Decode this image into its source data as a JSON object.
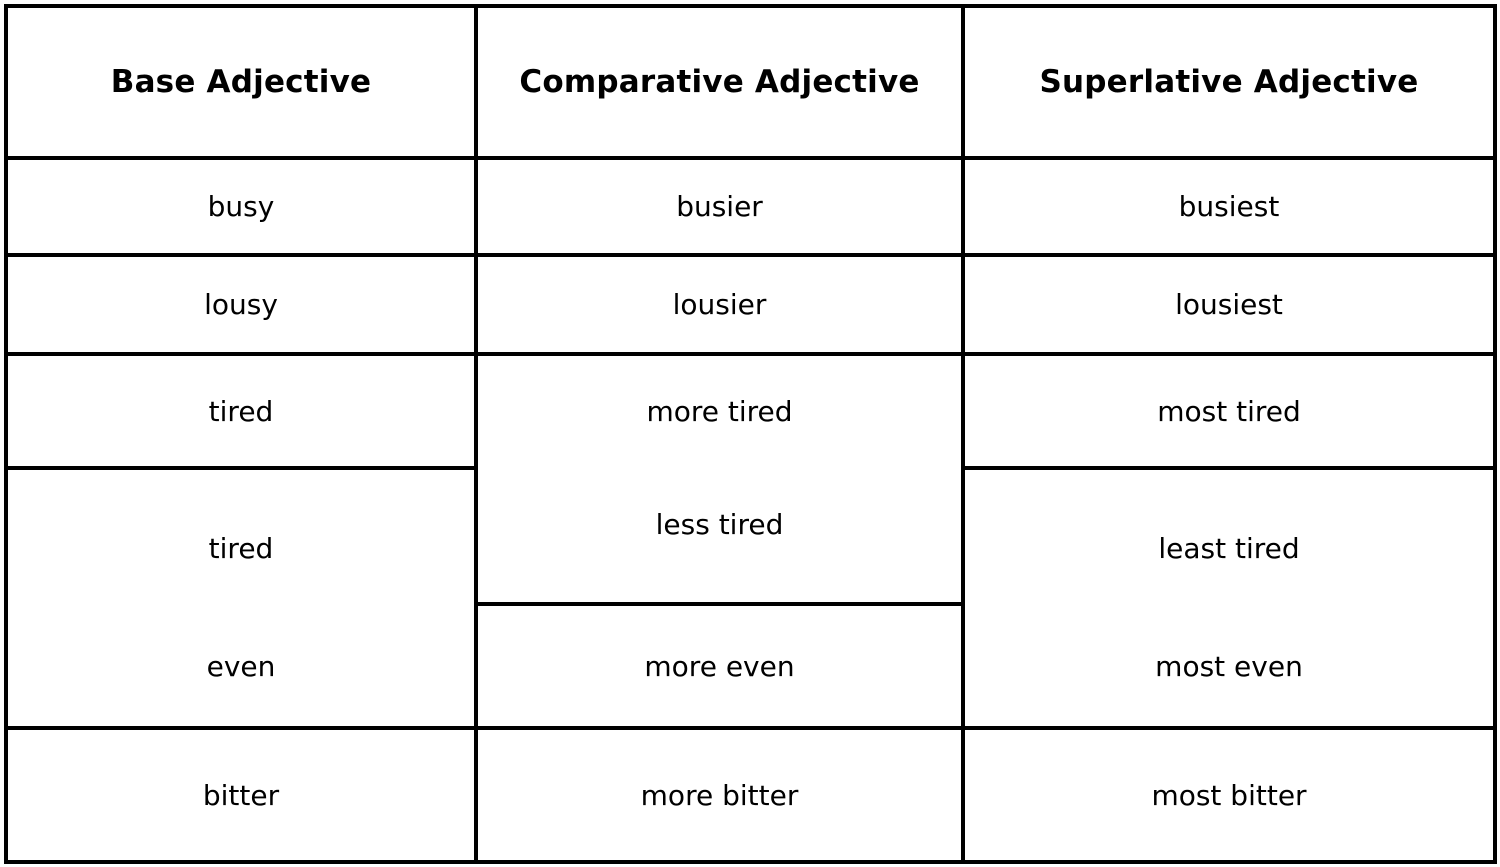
{
  "table": {
    "headers": [
      "Base Adjective",
      "Comparative Adjective",
      "Superlative Adjective"
    ],
    "rows": [
      {
        "base": "busy",
        "comparative": "busier",
        "superlative": "busiest"
      },
      {
        "base": "lousy",
        "comparative": "lousier",
        "superlative": "lousiest"
      },
      {
        "base": "tired",
        "comparative": "more tired",
        "superlative": "most tired"
      },
      {
        "base": "tired",
        "comparative": "less tired",
        "superlative": "least tired"
      },
      {
        "base": "even",
        "comparative": "more even",
        "superlative": "most even"
      },
      {
        "base": "bitter",
        "comparative": "more bitter",
        "superlative": "most bitter"
      }
    ]
  },
  "colors": {
    "border": "#000000",
    "background": "#ffffff",
    "text": "#000000"
  }
}
